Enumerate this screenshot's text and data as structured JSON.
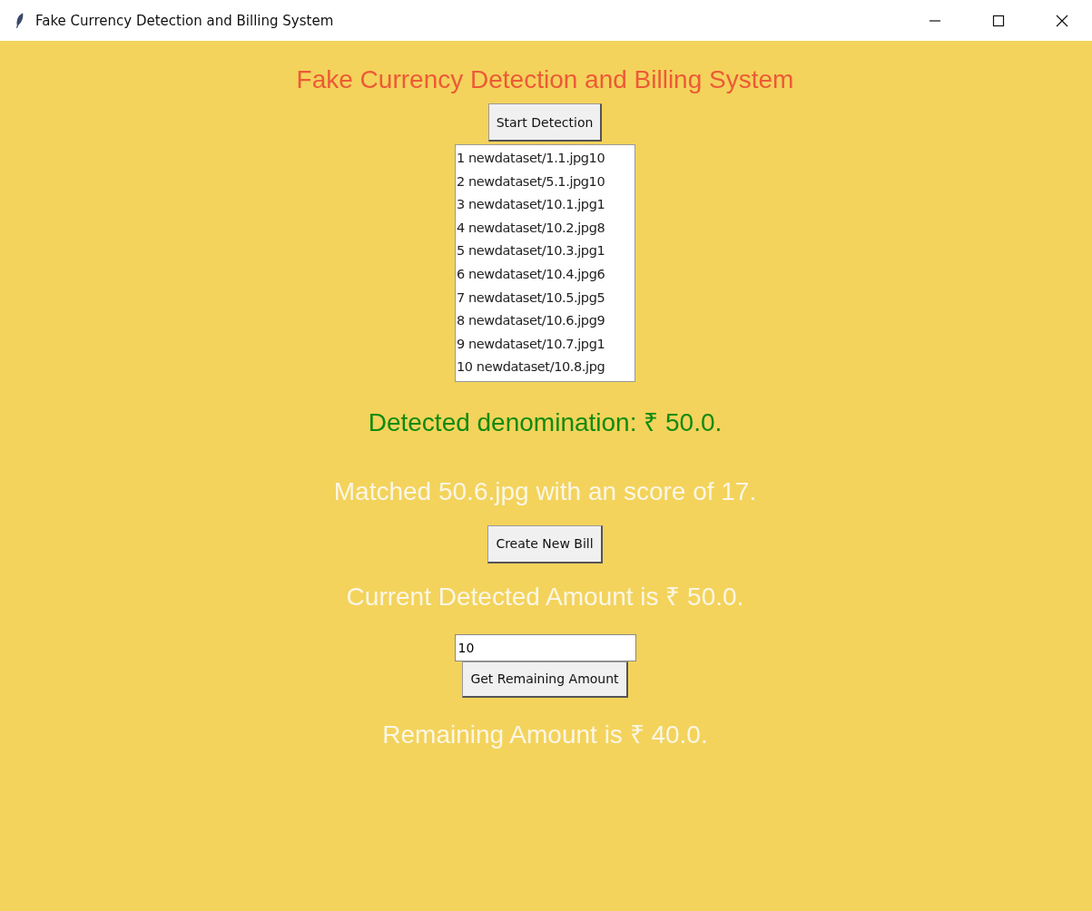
{
  "window": {
    "title": "Fake Currency Detection and Billing System"
  },
  "heading": "Fake Currency Detection and Billing System",
  "start_button": "Start Detection",
  "results_list": [
    "1 newdataset/1.1.jpg10",
    "2 newdataset/5.1.jpg10",
    "3 newdataset/10.1.jpg1",
    "4 newdataset/10.2.jpg8",
    "5 newdataset/10.3.jpg1",
    "6 newdataset/10.4.jpg6",
    "7 newdataset/10.5.jpg5",
    "8 newdataset/10.6.jpg9",
    "9 newdataset/10.7.jpg1",
    "10 newdataset/10.8.jpg"
  ],
  "detected": "Detected denomination: ₹ 50.0.",
  "matched": "Matched 50.6.jpg with an score of 17.",
  "bill_button": "Create New Bill",
  "current_amount": "Current Detected Amount is ₹ 50.0.",
  "amount_field": {
    "value": "10"
  },
  "remaining_button": "Get Remaining Amount",
  "remaining": "Remaining Amount is ₹ 40.0."
}
